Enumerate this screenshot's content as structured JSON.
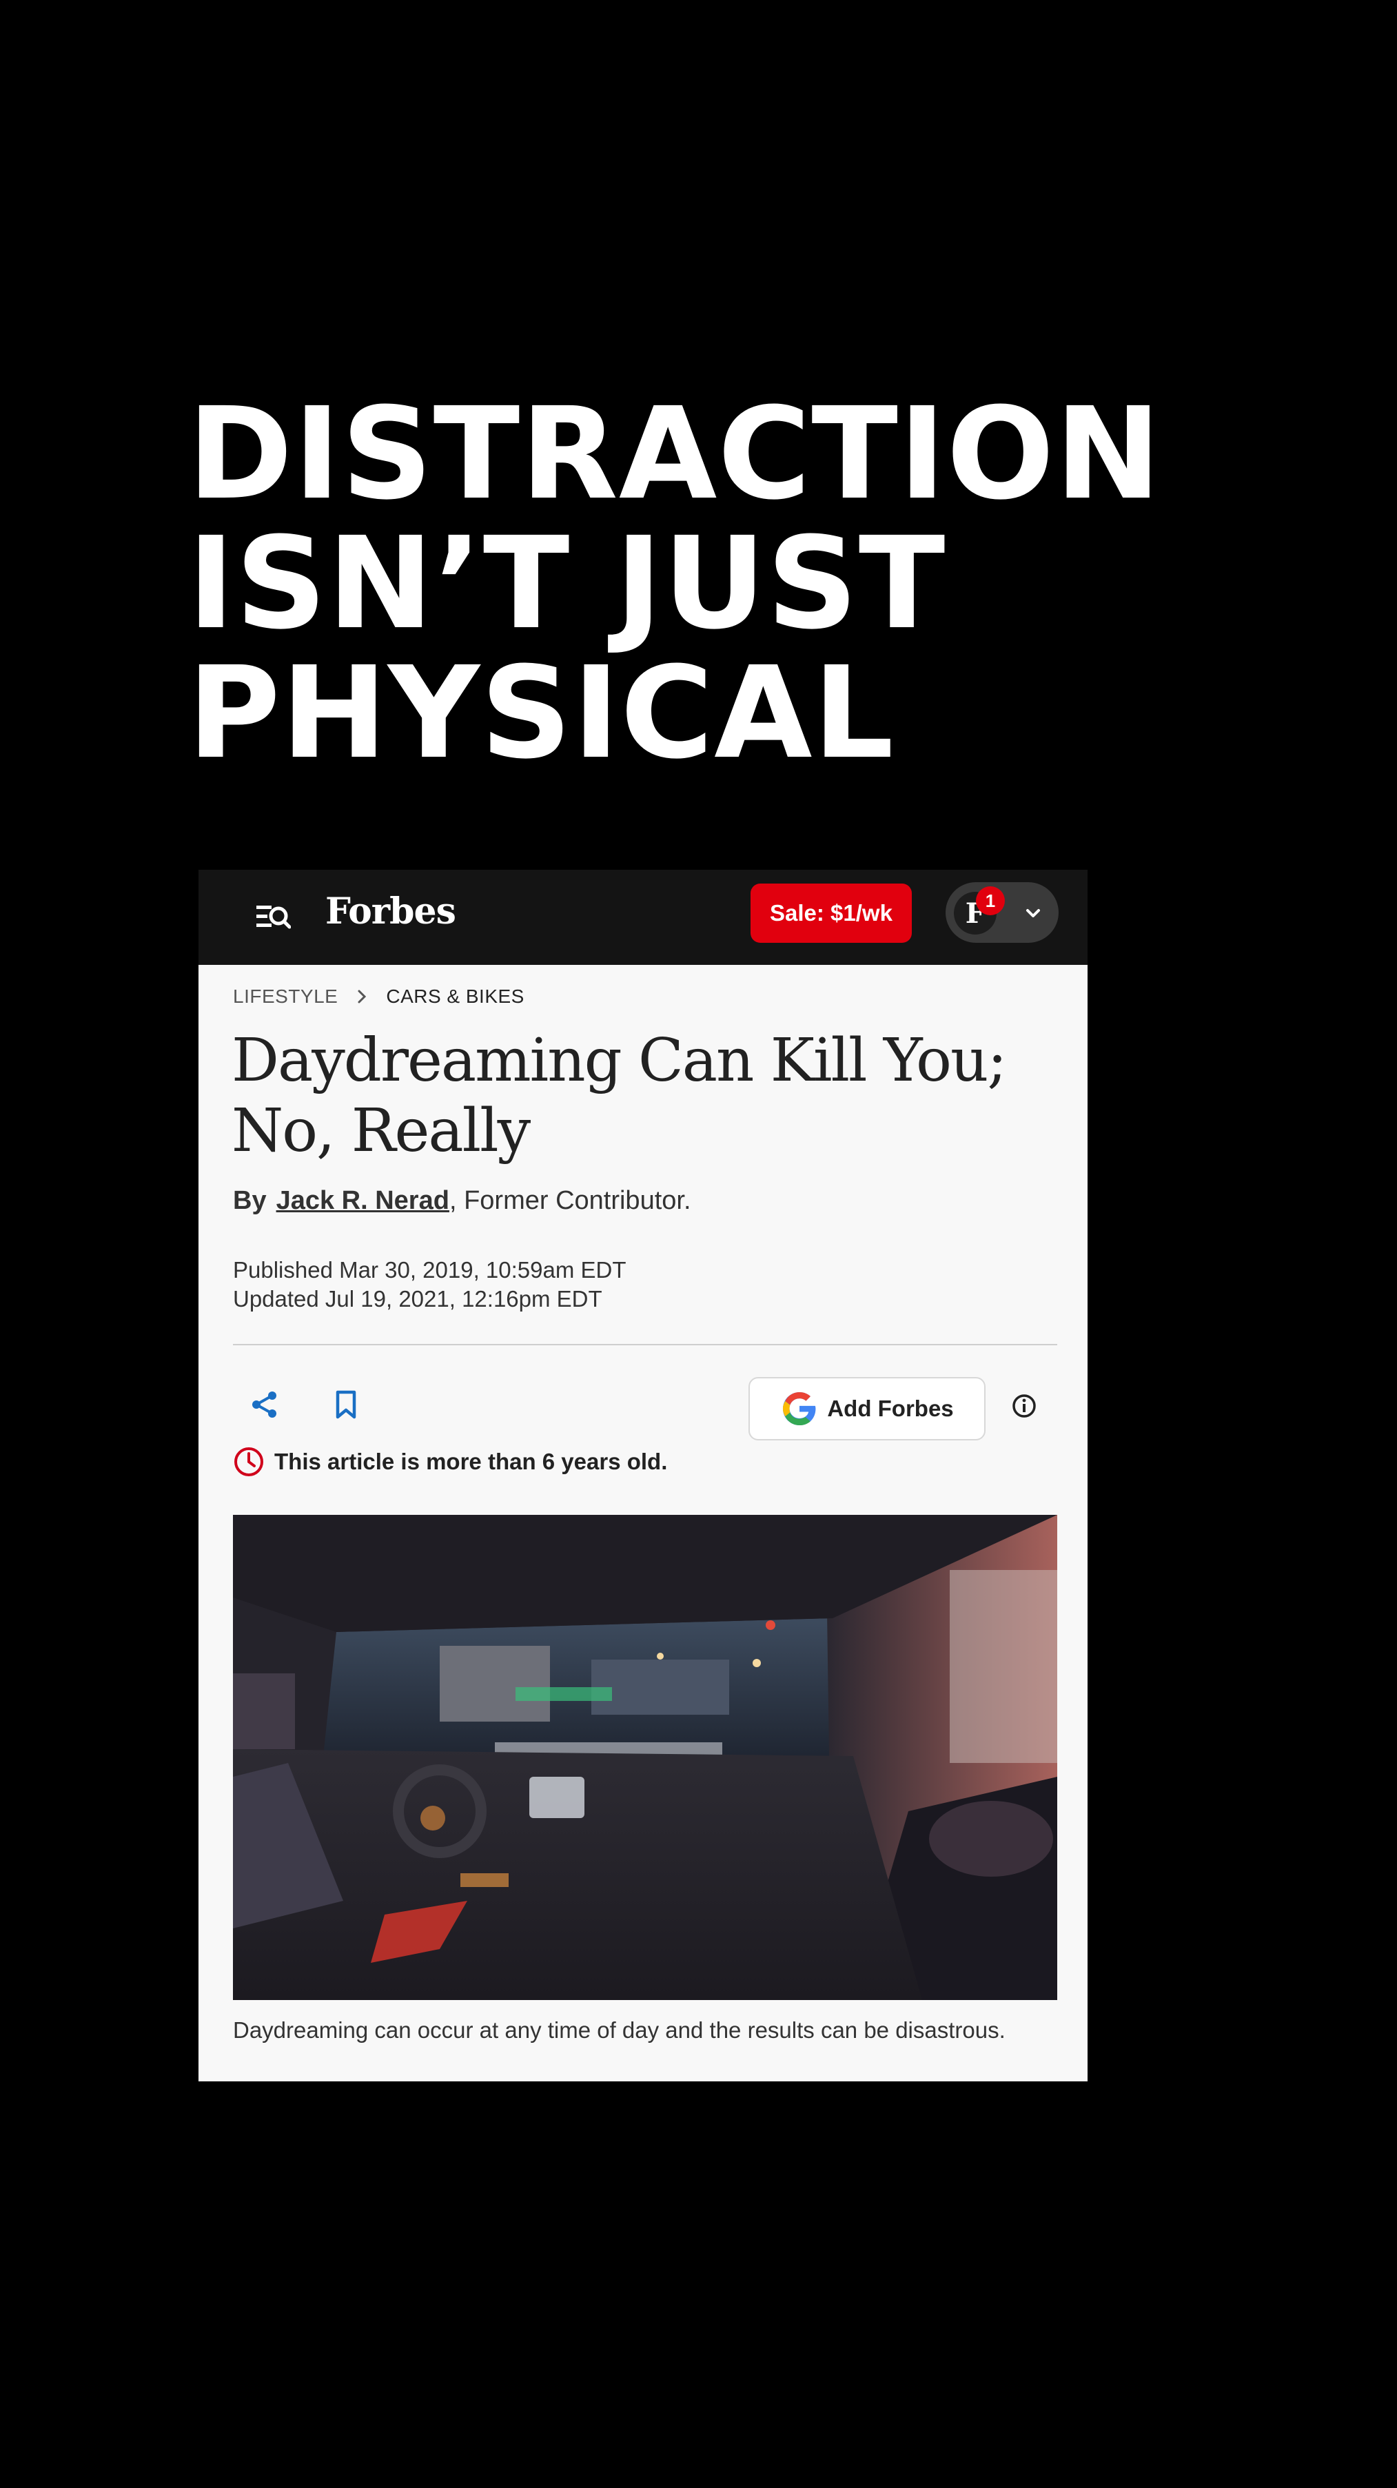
{
  "headline": {
    "line1": "DISTRACTION",
    "line2": "ISN’T JUST",
    "line3": "PHYSICAL"
  },
  "topbar": {
    "brand": "Forbes",
    "sale_label": "Sale: $1/wk",
    "avatar_initial": "F",
    "notification_count": "1",
    "background_color": "#141414",
    "sale_color": "#e1000e"
  },
  "breadcrumb": {
    "items": [
      "LIFESTYLE",
      "CARS & BIKES"
    ]
  },
  "article": {
    "title": "Daydreaming Can Kill You; No, Really",
    "by_label": "By",
    "author": "Jack R. Nerad",
    "author_suffix": ", Former Contributor.",
    "published": "Published Mar 30, 2019, 10:59am EDT",
    "updated": "Updated Jul 19, 2021, 12:16pm EDT",
    "add_forbes_label": "Add Forbes",
    "age_notice": "This article is more than 6 years old.",
    "caption": "Daydreaming can occur at any time of day and the results can be disastrous."
  },
  "icons": [
    "menu-search-icon",
    "chevron-down-icon",
    "chevron-right-icon",
    "share-icon",
    "bookmark-icon",
    "google-icon",
    "info-icon",
    "clock-icon"
  ]
}
